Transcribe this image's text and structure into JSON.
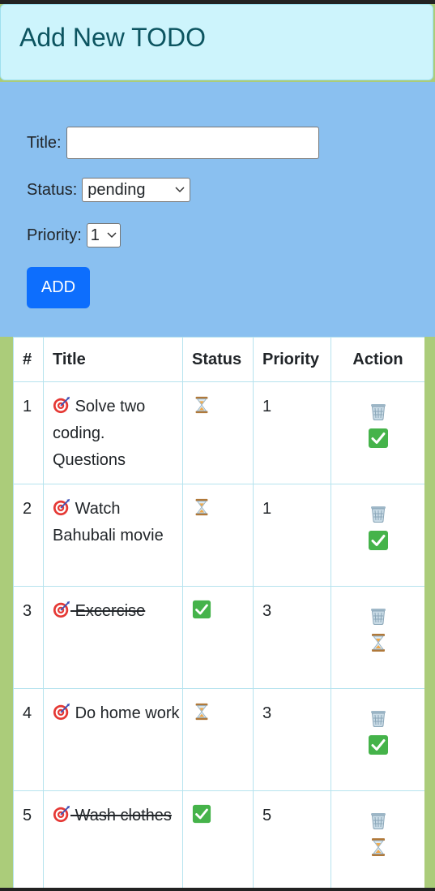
{
  "header": {
    "title": "Add New TODO"
  },
  "form": {
    "title_label": "Title:",
    "title_value": "",
    "status_label": "Status:",
    "status_value": "pending",
    "priority_label": "Priority:",
    "priority_value": "1",
    "add_label": "ADD"
  },
  "table": {
    "headers": {
      "num": "#",
      "title": "Title",
      "status": "Status",
      "priority": "Priority",
      "action": "Action"
    },
    "rows": [
      {
        "num": "1",
        "title_icon": "🎯",
        "title": "Solve two coding. Questions",
        "status": "pending",
        "status_icon": "hourglass-icon",
        "priority": "1",
        "done": false
      },
      {
        "num": "2",
        "title_icon": "🎯",
        "title": "Watch Bahubali movie",
        "status": "pending",
        "status_icon": "hourglass-icon",
        "priority": "1",
        "done": false
      },
      {
        "num": "3",
        "title_icon": "🎯",
        "title": "Excercise",
        "status": "done",
        "status_icon": "check-icon",
        "priority": "3",
        "done": true
      },
      {
        "num": "4",
        "title_icon": "🎯",
        "title": "Do home work",
        "status": "pending",
        "status_icon": "hourglass-icon",
        "priority": "3",
        "done": false
      },
      {
        "num": "5",
        "title_icon": "🎯",
        "title": "Wash clothes",
        "status": "done",
        "status_icon": "check-icon",
        "priority": "5",
        "done": true
      }
    ]
  },
  "colors": {
    "page_background": "#abcc7a",
    "form_background": "#8ac0f0",
    "header_background": "#cdf4fc",
    "header_text": "#0c5460",
    "add_button": "#0d6efd",
    "table_border": "#b6e3ee"
  }
}
